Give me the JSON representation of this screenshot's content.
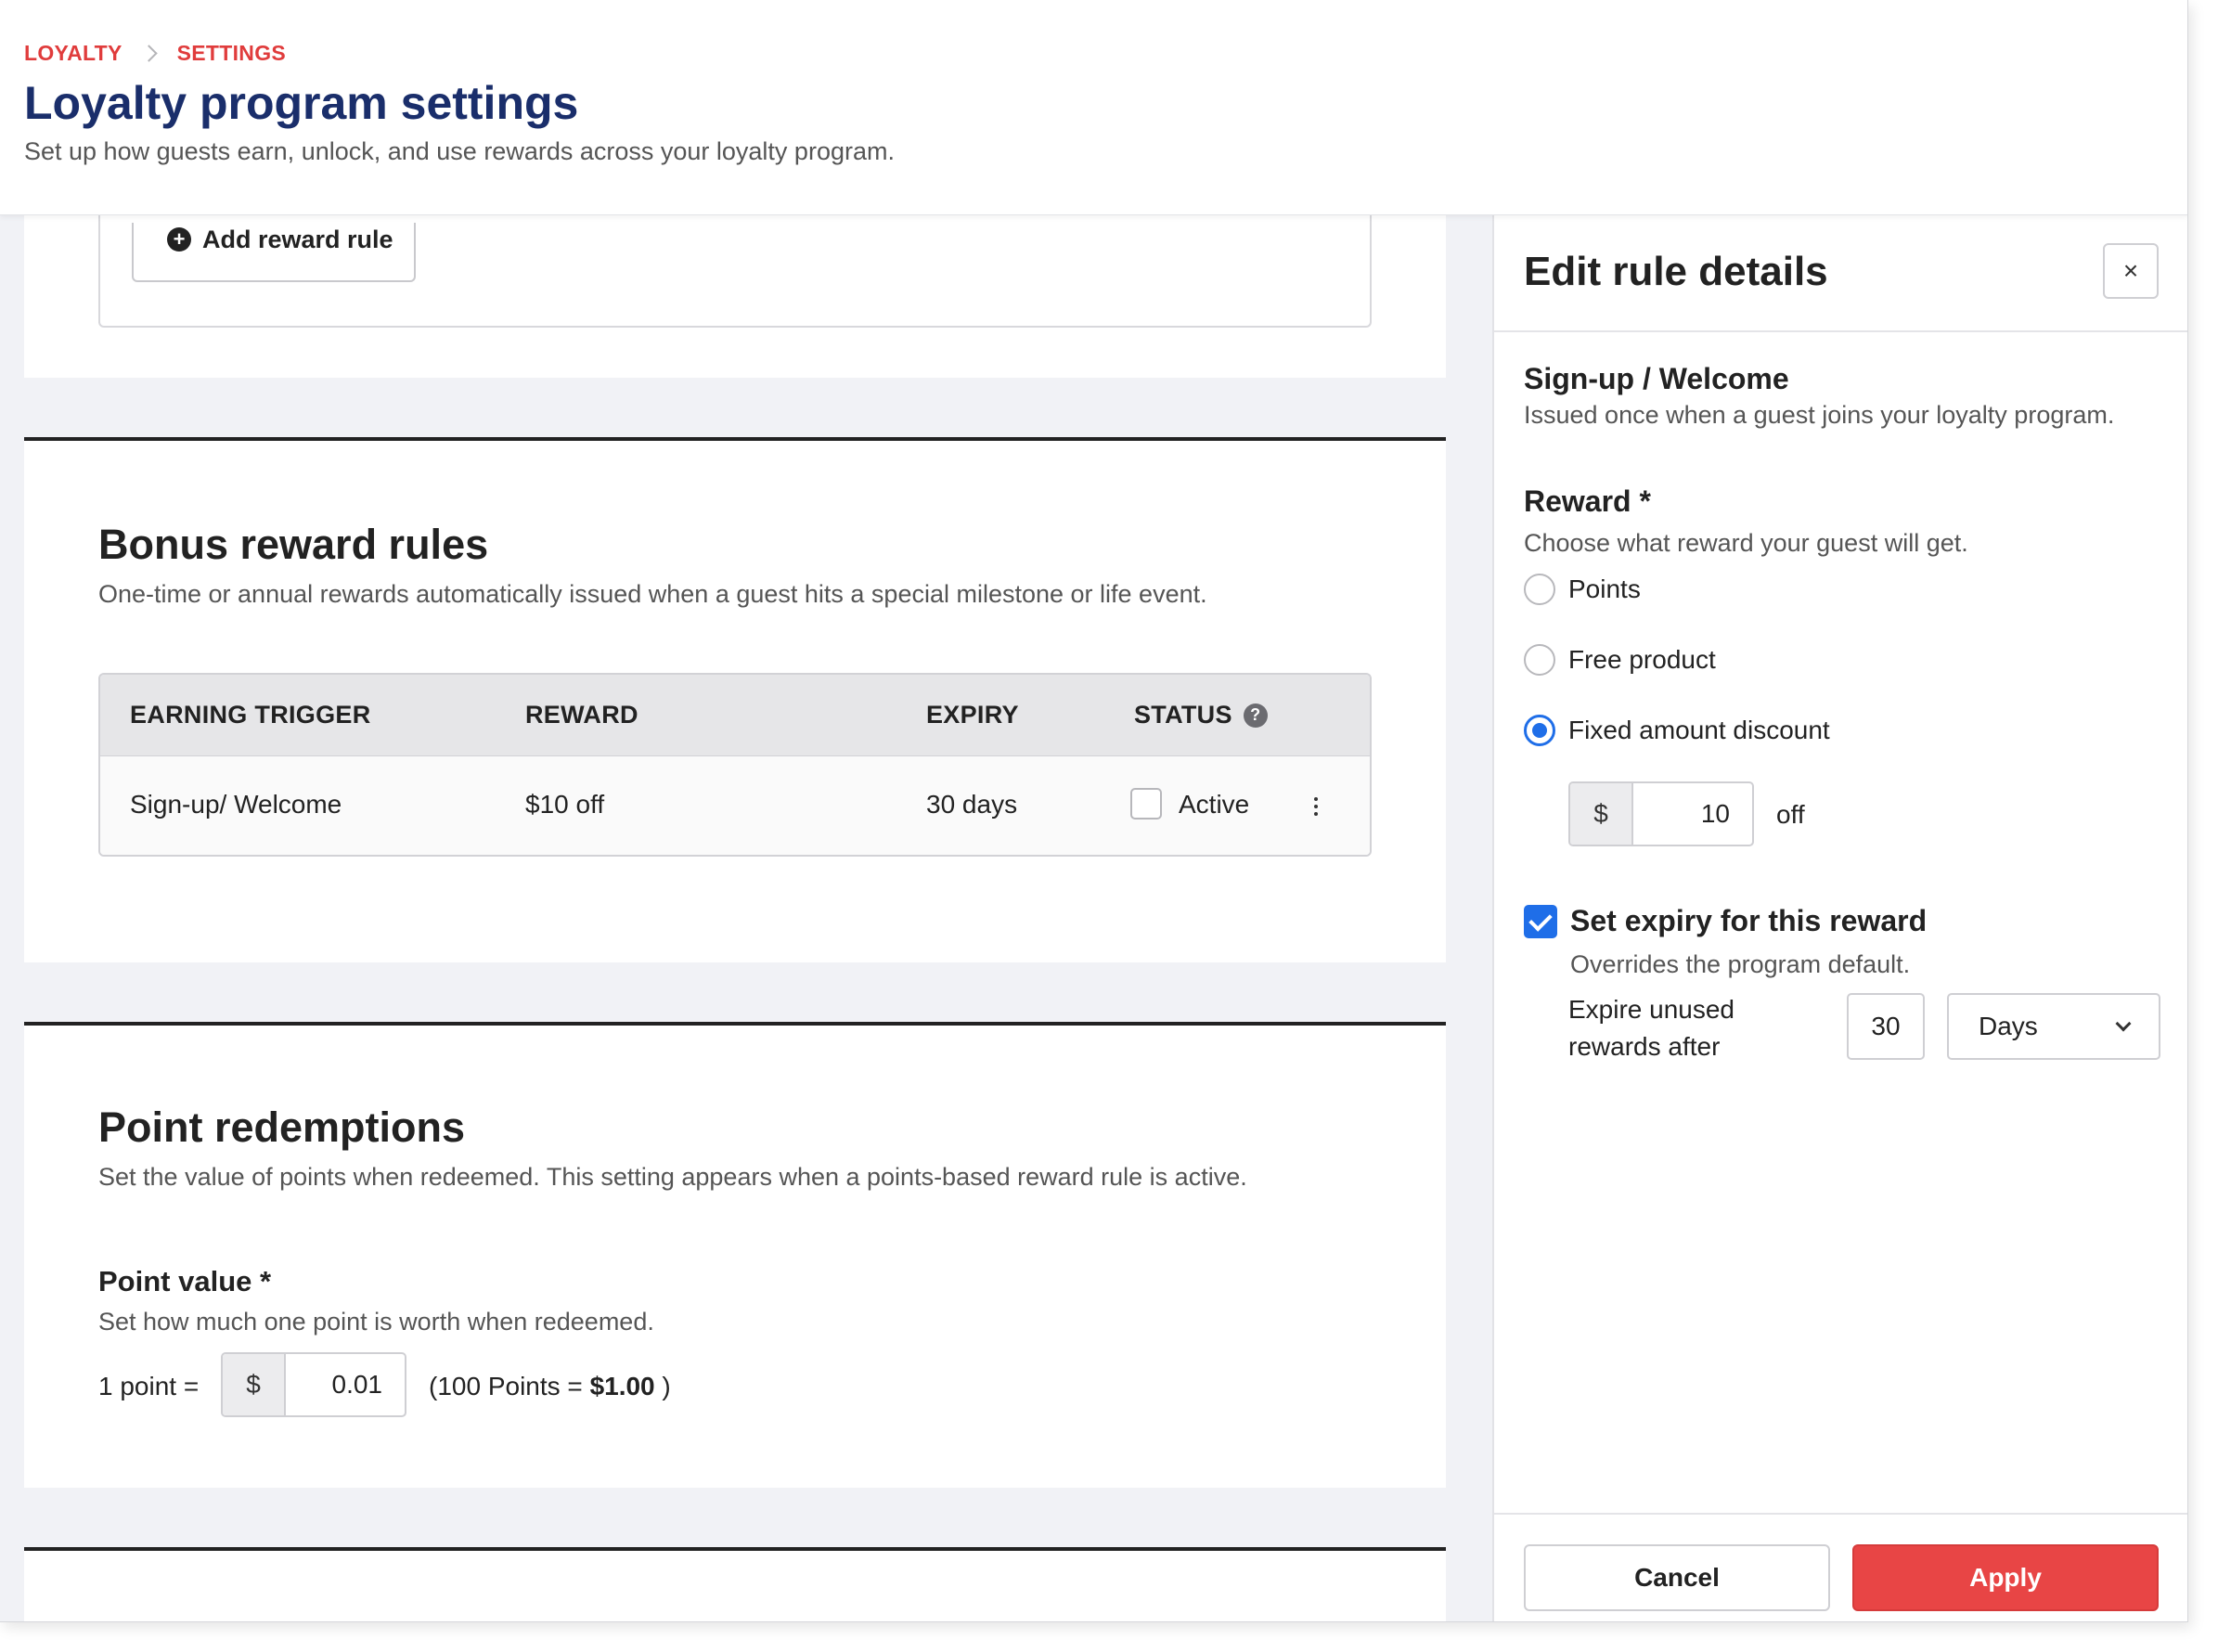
{
  "breadcrumb": {
    "items": [
      "LOYALTY",
      "SETTINGS"
    ]
  },
  "header": {
    "title": "Loyalty program settings",
    "subtitle": "Set up how guests earn, unlock, and use rewards across your loyalty program."
  },
  "reward_rules": {
    "add_button_label": "Add reward rule"
  },
  "bonus": {
    "title": "Bonus reward rules",
    "description": "One-time or annual rewards automatically issued when a guest hits a special milestone or life event.",
    "columns": [
      "EARNING TRIGGER",
      "REWARD",
      "EXPIRY",
      "STATUS"
    ],
    "rows": [
      {
        "trigger": "Sign-up/ Welcome",
        "reward": "$10 off",
        "expiry": "30 days",
        "status": "Active"
      }
    ]
  },
  "redemptions": {
    "title": "Point redemptions",
    "description": "Set the value of points when redeemed. This setting appears when a points-based reward rule is active.",
    "point_value_label": "Point value *",
    "point_value_help": "Set how much one point is worth when redeemed.",
    "prefix": "1 point =",
    "currency": "$",
    "value": "0.01",
    "equivalence_prefix": "(100 Points = ",
    "equivalence_amount": "$1.00",
    "equivalence_suffix": " )"
  },
  "drawer": {
    "title": "Edit rule details",
    "close_icon": "×",
    "rule_name": "Sign-up / Welcome",
    "rule_desc": "Issued once when a guest joins your loyalty program.",
    "reward_label": "Reward *",
    "reward_help": "Choose what reward your guest will get.",
    "options": [
      "Points",
      "Free product",
      "Fixed amount discount"
    ],
    "selected_option": "Fixed amount discount",
    "discount_currency": "$",
    "discount_value": "10",
    "discount_suffix": "off",
    "expiry_checkbox_label": "Set expiry for this reward",
    "expiry_help": "Overrides the program default.",
    "expire_after_label": "Expire unused rewards after",
    "expire_value": "30",
    "expire_unit": "Days",
    "cancel_label": "Cancel",
    "apply_label": "Apply"
  },
  "colors": {
    "accent": "#e84545",
    "brand_title": "#1a2e6b",
    "primary_blue": "#1f6ee8"
  }
}
